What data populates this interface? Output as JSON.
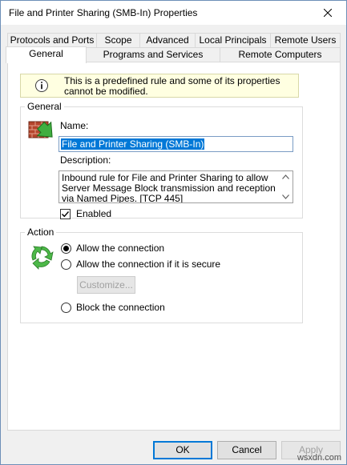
{
  "window": {
    "title": "File and Printer Sharing (SMB-In) Properties"
  },
  "tabs": {
    "row1": [
      "Protocols and Ports",
      "Scope",
      "Advanced",
      "Local Principals",
      "Remote Users"
    ],
    "row2": [
      "General",
      "Programs and Services",
      "Remote Computers"
    ],
    "active": "General"
  },
  "info": {
    "text": "This is a predefined rule and some of its properties cannot be modified."
  },
  "general": {
    "legend": "General",
    "name_label": "Name:",
    "name_value": "File and Printer Sharing (SMB-In)",
    "description_label": "Description:",
    "description_value": "Inbound rule for File and Printer Sharing to allow Server Message Block transmission and reception via Named Pipes. [TCP 445]",
    "enabled_label": "Enabled",
    "enabled": true
  },
  "action": {
    "legend": "Action",
    "allow_label": "Allow the connection",
    "allow_secure_label": "Allow the connection if it is secure",
    "customize_label": "Customize...",
    "block_label": "Block the connection",
    "selected": "allow"
  },
  "buttons": {
    "ok": "OK",
    "cancel": "Cancel",
    "apply": "Apply"
  },
  "watermark": "wsxdn.com",
  "colors": {
    "accent": "#0078d7",
    "banner": "#ffffe1"
  }
}
